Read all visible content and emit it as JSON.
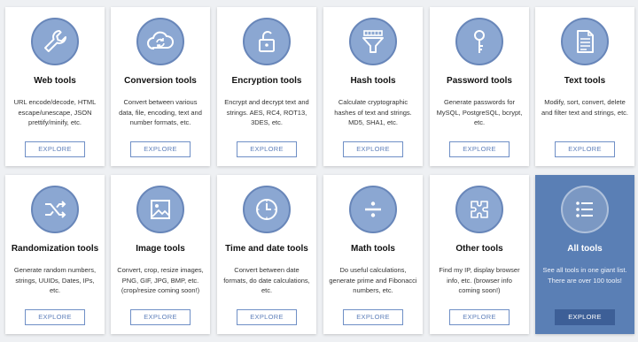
{
  "cards": [
    {
      "title": "Web tools",
      "desc": "URL encode/decode, HTML escape/unescape, JSON prettify/minify, etc.",
      "button": "EXPLORE",
      "icon": "wrench-icon"
    },
    {
      "title": "Conversion tools",
      "desc": "Convert between various data, file, encoding, text and number formats, etc.",
      "button": "EXPLORE",
      "icon": "cloud-sync-icon"
    },
    {
      "title": "Encryption tools",
      "desc": "Encrypt and decrypt text and strings. AES, RC4, ROT13, 3DES, etc.",
      "button": "EXPLORE",
      "icon": "lock-icon"
    },
    {
      "title": "Hash tools",
      "desc": "Calculate cryptographic hashes of text and strings. MD5, SHA1, etc.",
      "button": "EXPLORE",
      "icon": "funnel-icon"
    },
    {
      "title": "Password tools",
      "desc": "Generate passwords for MySQL, PostgreSQL, bcrypt, etc.",
      "button": "EXPLORE",
      "icon": "key-icon"
    },
    {
      "title": "Text tools",
      "desc": "Modify, sort, convert, delete and filter text and strings, etc.",
      "button": "EXPLORE",
      "icon": "document-icon"
    },
    {
      "title": "Randomization tools",
      "desc": "Generate random numbers, strings, UUIDs, Dates, IPs, etc.",
      "button": "EXPLORE",
      "icon": "shuffle-icon"
    },
    {
      "title": "Image tools",
      "desc": "Convert, crop, resize images, PNG, GIF, JPG, BMP, etc. (crop/resize coming soon!)",
      "button": "EXPLORE",
      "icon": "image-icon"
    },
    {
      "title": "Time and date tools",
      "desc": "Convert between date formats, do date calculations, etc.",
      "button": "EXPLORE",
      "icon": "clock-icon"
    },
    {
      "title": "Math tools",
      "desc": "Do useful calculations, generate prime and Fibonacci numbers, etc.",
      "button": "EXPLORE",
      "icon": "divide-icon"
    },
    {
      "title": "Other tools",
      "desc": "Find my IP, display browser info, etc. (browser info coming soon!)",
      "button": "EXPLORE",
      "icon": "puzzle-icon"
    },
    {
      "title": "All tools",
      "desc": "See all tools in one giant list. There are over 100 tools!",
      "button": "EXPLORE",
      "icon": "list-icon"
    }
  ]
}
